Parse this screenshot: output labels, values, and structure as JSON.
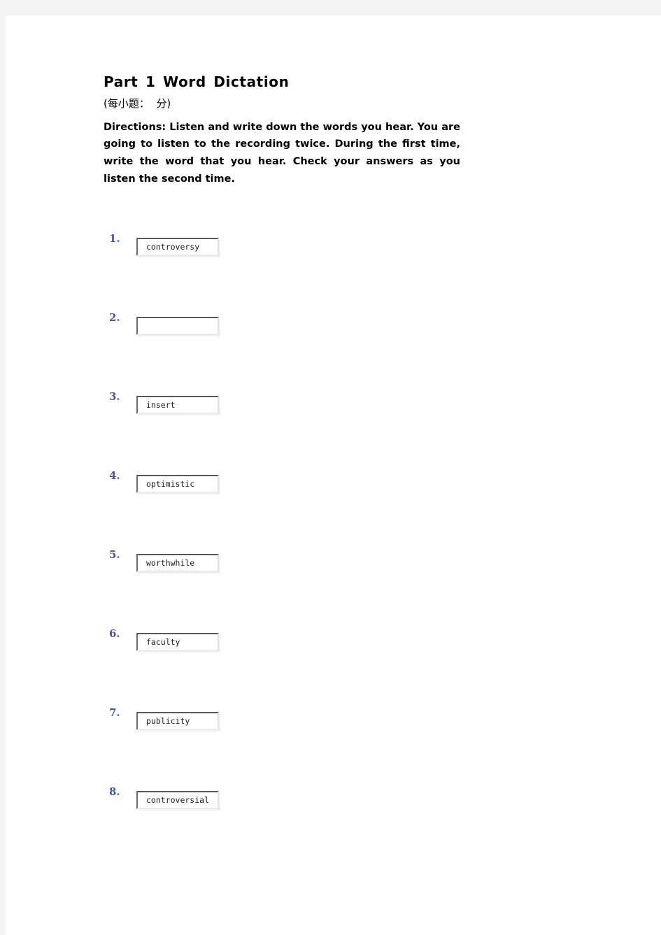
{
  "document": {
    "title": "Part 1 Word Dictation",
    "score_line": "(每小题：  分)",
    "directions": "Directions: Listen and write down the words you hear. You are going to listen to the recording twice. During the first time, write the word that you hear. Check your answers as you listen the second time."
  },
  "theme": {
    "page_background": "#ffffff",
    "canvas_background": "#f4f4f4",
    "number_color": "#4257b2",
    "text_color": "#000000"
  },
  "questions": [
    {
      "number": "1.",
      "answer": "controversy",
      "placeholder": ""
    },
    {
      "number": "2.",
      "answer": "",
      "placeholder": ""
    },
    {
      "number": "3.",
      "answer": "insert",
      "placeholder": ""
    },
    {
      "number": "4.",
      "answer": "optimistic",
      "placeholder": ""
    },
    {
      "number": "5.",
      "answer": "worthwhile",
      "placeholder": ""
    },
    {
      "number": "6.",
      "answer": "faculty",
      "placeholder": ""
    },
    {
      "number": "7.",
      "answer": "publicity",
      "placeholder": ""
    },
    {
      "number": "8.",
      "answer": "controversial",
      "placeholder": ""
    }
  ]
}
